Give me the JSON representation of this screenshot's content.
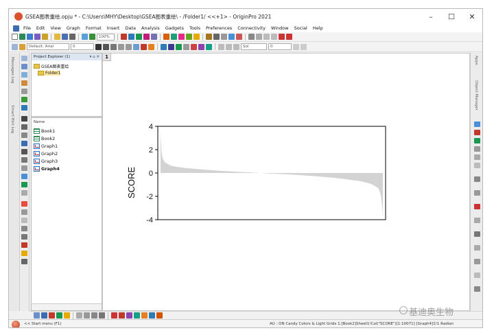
{
  "window": {
    "title": "GSEA图表重绘.opju * - C:\\Users\\MHY\\Desktop\\GSEA图表重绘\\ - /Folder1/ <<+1> - OriginPro 2021",
    "minimize": "–",
    "maximize": "☐",
    "close": "✕"
  },
  "menu": [
    "File",
    "Edit",
    "View",
    "Graph",
    "Format",
    "Insert",
    "Data",
    "Analysis",
    "Gadgets",
    "Tools",
    "Preferences",
    "Connectivity",
    "Window",
    "Social",
    "Help"
  ],
  "toolbar": {
    "zoom": "100%",
    "font_theme": "Default: Arial",
    "font_size": "0",
    "line_style": "Sol",
    "line_width": "0"
  },
  "side_tabs": [
    "Messages Log",
    "Smart Hint Log"
  ],
  "right_tabs": [
    "Apps",
    "Object Manager"
  ],
  "project_explorer": {
    "title": "Project Explorer (1)",
    "controls": "▾ ⌂ ✕",
    "root": "GSEA图表重绘",
    "folder": "Folder1",
    "column_header": "Name",
    "items": [
      {
        "name": "Book1",
        "kind": "book",
        "bold": false
      },
      {
        "name": "Book2",
        "kind": "book",
        "bold": false
      },
      {
        "name": "Graph1",
        "kind": "graph",
        "bold": false
      },
      {
        "name": "Graph2",
        "kind": "graph",
        "bold": false
      },
      {
        "name": "Graph3",
        "kind": "graph",
        "bold": false
      },
      {
        "name": "Graph4",
        "kind": "graph",
        "bold": true
      }
    ]
  },
  "workspace": {
    "window_number": "1"
  },
  "chart_data": {
    "type": "area",
    "title": "",
    "xlabel": "",
    "ylabel": "SCORE",
    "ylim": [
      -4,
      4
    ],
    "yticks": [
      4,
      2,
      0,
      -2,
      -4
    ],
    "grid": false,
    "fill_color": "#d3d3d3",
    "x": [
      0,
      0.005,
      0.01,
      0.02,
      0.05,
      0.1,
      0.2,
      0.3,
      0.4,
      0.5,
      0.6,
      0.7,
      0.8,
      0.9,
      0.95,
      0.98,
      0.99,
      0.995,
      1.0
    ],
    "values": [
      3.3,
      1.7,
      1.2,
      0.9,
      0.6,
      0.45,
      0.28,
      0.15,
      0.05,
      -0.05,
      -0.15,
      -0.28,
      -0.45,
      -0.7,
      -0.95,
      -1.3,
      -1.8,
      -2.5,
      -3.6
    ]
  },
  "status": {
    "left": "<< Start menu (F1)",
    "right": "AU : ON Candy Colors & Light Grids 1:[Book2]Sheet1!Col(\"SCORE\")[1:10071] [Graph4]1!1 Radian"
  },
  "watermark": "基迪奥生物"
}
